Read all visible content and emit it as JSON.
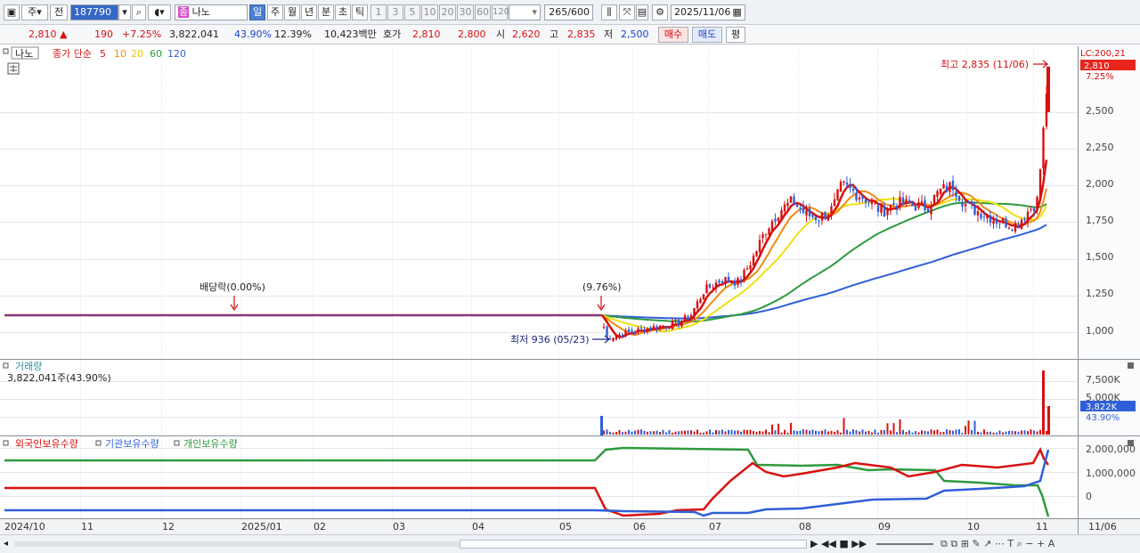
{
  "toolbar": {
    "market_label": "주",
    "prev_label": "전",
    "code": "187790",
    "name": "나노",
    "name_prefix": "종",
    "period_tabs": [
      "일",
      "주",
      "월",
      "년",
      "분",
      "초",
      "틱"
    ],
    "active_period": "일",
    "interval_buttons": [
      "1",
      "3",
      "5",
      "10",
      "20",
      "30",
      "60",
      "120"
    ],
    "count": "265",
    "count_total": "/600",
    "date": "2025/11/06"
  },
  "quote": {
    "price": "2,810",
    "change": "190",
    "change_pct": "+7.25%",
    "volume": "3,822,041",
    "volume_pct": "43.90%",
    "turnover_pct": "12.39%",
    "amount": "10,423백만",
    "ask_label": "호가",
    "ask": "2,810",
    "bid": "2,800",
    "open_label": "시",
    "open": "2,620",
    "high_label": "고",
    "high": "2,835",
    "low_label": "저",
    "low": "2,500",
    "buy_label": "매수",
    "sell_label": "매도",
    "eval_label": "평"
  },
  "price_panel": {
    "name_tag": "나노",
    "ma_title": "종가 단순",
    "ma_periods": [
      "5",
      "10",
      "20",
      "60",
      "120"
    ],
    "ma_colors": [
      "#d81010",
      "#f08a10",
      "#f0e010",
      "#2e9a3e",
      "#2f5fd8"
    ],
    "lc_label": "LC:200,21",
    "current_price": "2,810",
    "current_pct": "7.25%",
    "high_annotation": "최고 2,835 (11/06)",
    "low_annotation": "최저 936 (05/23)",
    "dividend_label": "배당락(0.00%)",
    "event_label": "(9.76%)",
    "y_ticks": [
      "2,500",
      "2,250",
      "2,000",
      "1,750",
      "1,500",
      "1,250",
      "1,000"
    ]
  },
  "volume_panel": {
    "title": "거래량",
    "summary": "3,822,041주(43.90%)",
    "y_ticks": [
      "7,500K",
      "5,000K"
    ],
    "current": "3,822K",
    "current_pct": "43.90%"
  },
  "holdings_panel": {
    "series_labels": [
      "외국인보유수량",
      "기관보유수량",
      "개인보유수량"
    ],
    "series_colors": [
      "#d81010",
      "#2f5fd8",
      "#2e9a3e"
    ],
    "y_ticks": [
      "2,000,000",
      "1,000,000",
      "0"
    ]
  },
  "x_axis": {
    "labels": [
      "2024/10",
      "11",
      "12",
      "2025/01",
      "02",
      "03",
      "04",
      "05",
      "06",
      "07",
      "08",
      "09",
      "10",
      "11"
    ],
    "right_label": "11/06"
  },
  "chart_data": {
    "type": "line",
    "title": "",
    "approx_close": [
      [
        "2024-10",
        1115
      ],
      [
        "2025-05-20",
        1115
      ],
      [
        "2025-05-23",
        960
      ],
      [
        "2025-06-10",
        1030
      ],
      [
        "2025-06-25",
        1080
      ],
      [
        "2025-07-05",
        1280
      ],
      [
        "2025-07-20",
        1360
      ],
      [
        "2025-07-31",
        1500
      ],
      [
        "2025-08-10",
        1830
      ],
      [
        "2025-08-20",
        1780
      ],
      [
        "2025-08-31",
        2000
      ],
      [
        "2025-09-10",
        1900
      ],
      [
        "2025-09-25",
        1860
      ],
      [
        "2025-10-05",
        2000
      ],
      [
        "2025-10-20",
        1800
      ],
      [
        "2025-10-31",
        1730
      ],
      [
        "2025-11-06",
        2810
      ]
    ],
    "ylim": [
      900,
      2850
    ]
  }
}
